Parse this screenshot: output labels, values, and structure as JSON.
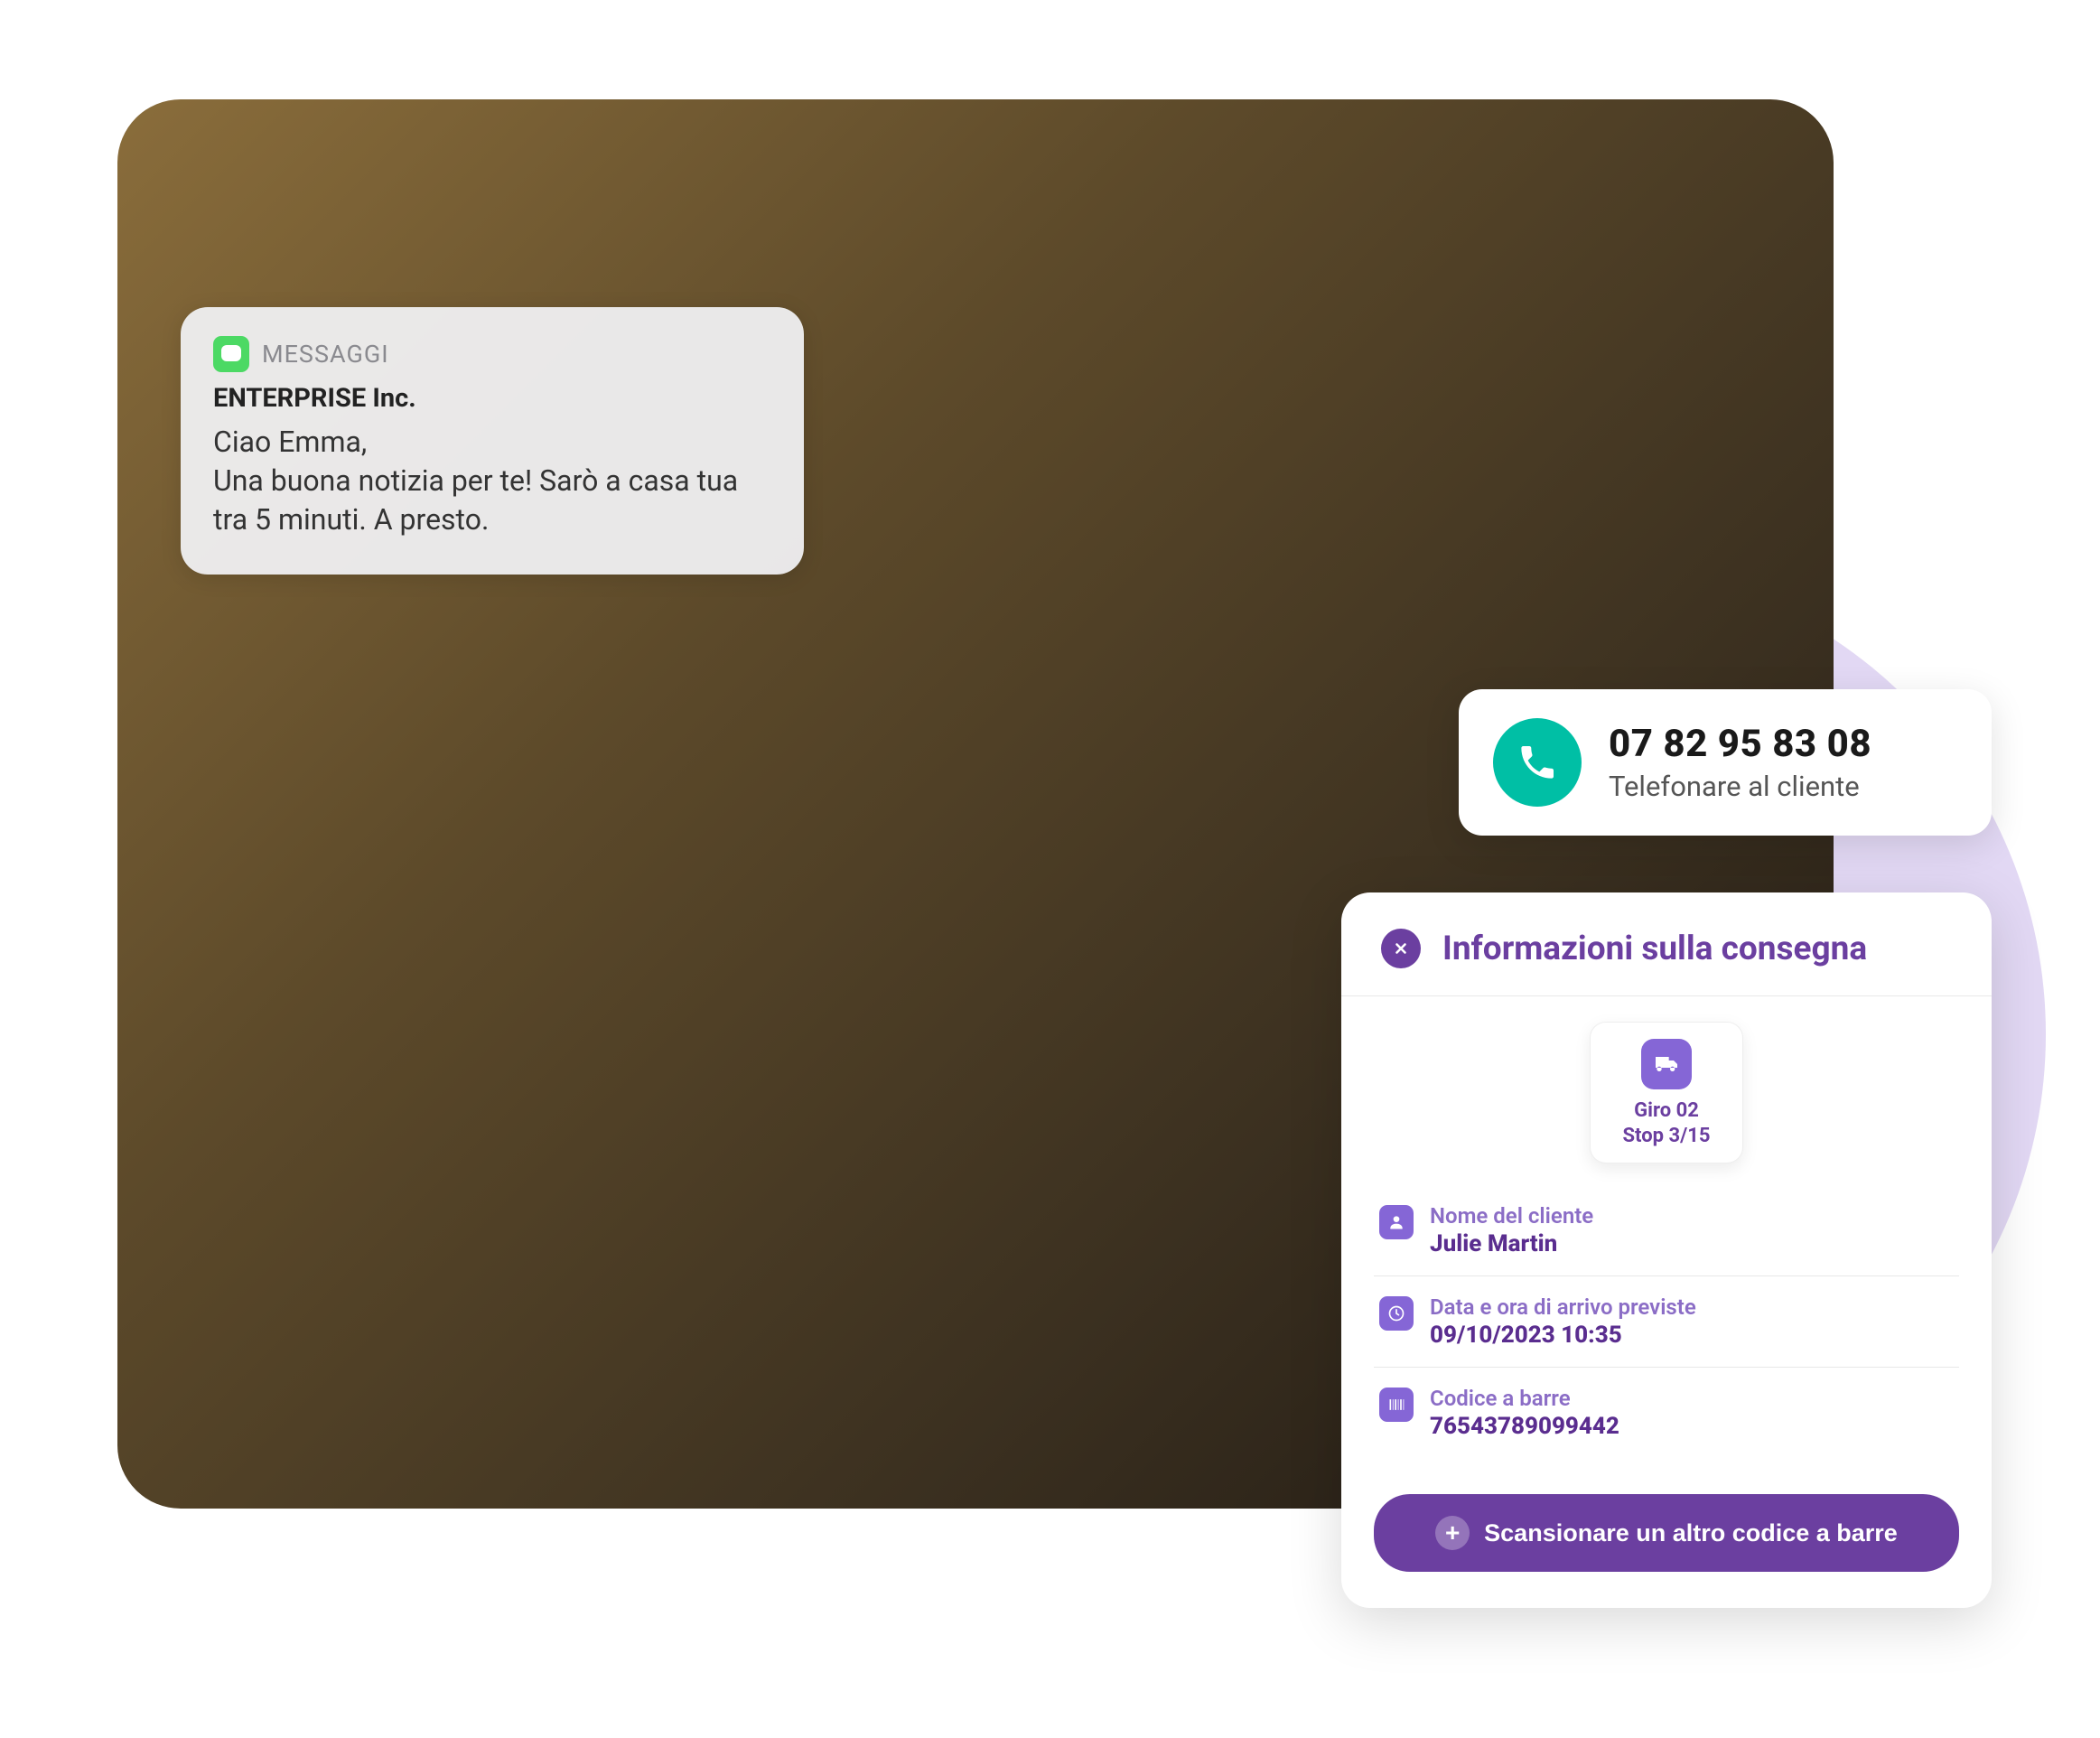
{
  "notification": {
    "app_label": "MESSAGGI",
    "sender": "ENTERPRISE Inc.",
    "body": "Ciao Emma,\nUna buona notizia per te! Sarò a casa tua tra 5 minuti. A presto."
  },
  "call": {
    "phone": "07 82 95 83 08",
    "label": "Telefonare al cliente"
  },
  "delivery": {
    "title": "Informazioni sulla consegna",
    "tour": {
      "line1": "Giro 02",
      "line2": "Stop 3/15"
    },
    "rows": {
      "customer": {
        "label": "Nome del cliente",
        "value": "Julie Martin"
      },
      "eta": {
        "label": "Data e ora di arrivo previste",
        "value": "09/10/2023 10:35"
      },
      "barcode": {
        "label": "Codice a barre",
        "value": "76543789099442"
      }
    },
    "scan_button": "Scansionare un altro codice a barre"
  }
}
